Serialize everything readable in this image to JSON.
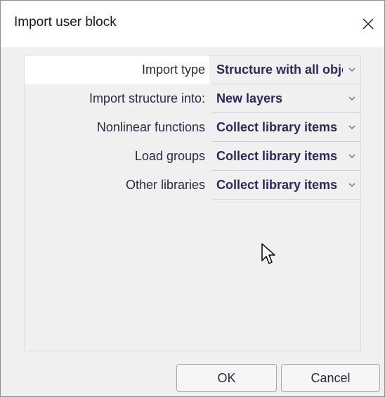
{
  "window": {
    "title": "Import user block",
    "close_icon": "close-icon"
  },
  "properties": [
    {
      "label": "Import type",
      "value": "Structure with all objects",
      "selected": true
    },
    {
      "label": "Import structure into:",
      "value": "New layers",
      "selected": false
    },
    {
      "label": "Nonlinear functions",
      "value": "Collect library items",
      "selected": false
    },
    {
      "label": "Load groups",
      "value": "Collect library items",
      "selected": false
    },
    {
      "label": "Other libraries",
      "value": "Collect library items",
      "selected": false
    }
  ],
  "buttons": {
    "ok_label": "OK",
    "cancel_label": "Cancel"
  },
  "colors": {
    "label_text": "#2a2a44",
    "value_text": "#2a2a5a",
    "selected_row_bg": "#ffffff",
    "dropdown_arrow": "#7a7f9a"
  }
}
